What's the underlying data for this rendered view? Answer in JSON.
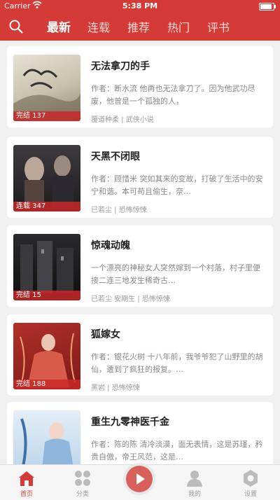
{
  "status": {
    "carrier": "Carrier",
    "time": "5:38 PM"
  },
  "nav": {
    "tabs": [
      "最新",
      "连载",
      "推荐",
      "热门",
      "评书"
    ]
  },
  "books": [
    {
      "title": "无法拿刀的手",
      "desc": "作者：断水流 他再也无法拿刀了。因为他武功尽废，他曾是一个孤独的人，",
      "author": "覆道种柔",
      "genre": "武侠小说",
      "status": "完结 137"
    },
    {
      "title": "天黑不闭眼",
      "desc": "作者：顾惜米 突如其来的变故，打破了生活中的安宁和谐。本可苟且偷生，奈…",
      "author": "已若尘",
      "genre": "恐怖惊悚",
      "status": "连载 347"
    },
    {
      "title": "惊魂动魄",
      "desc": "一个漂亮的神秘女人突然嫁到一个村落，村子里便接二连三地发生稀奇古…",
      "author": "已若尘 安期生",
      "genre": "恐怖惊悚",
      "status": "完结 15"
    },
    {
      "title": "狐嫁女",
      "desc": "作者：银花火树 十八年前，我爷爷犯了山野里的胡仙，遭到了疯狂的报复。…",
      "author": "黑岩",
      "genre": "恐怖惊悚",
      "status": "完结 188"
    },
    {
      "title": "重生九零神医千金",
      "desc": "作者：陈的陈 清冷淡漠，面无表情，这是苏瑾，矜贵自傲，帝王风范，这是…",
      "author": "",
      "genre": "",
      "status": ""
    }
  ],
  "bottom": {
    "items": [
      "首页",
      "分类",
      "",
      "我的",
      "设置"
    ]
  },
  "colors": {
    "brand": "#d43a36"
  }
}
